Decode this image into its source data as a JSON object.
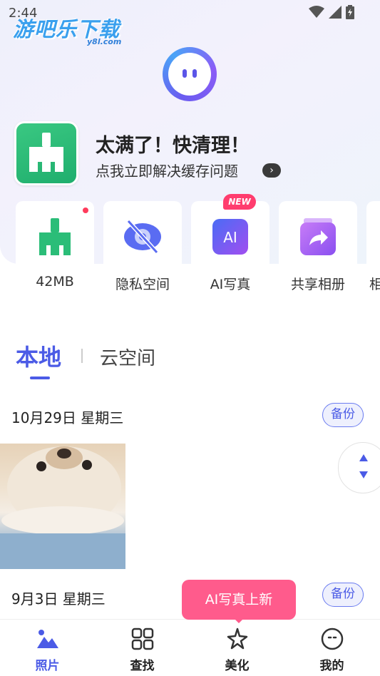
{
  "status_bar": {
    "time": "2:44"
  },
  "watermark": {
    "main": "游吧乐下载",
    "sub": "y8l.com"
  },
  "clean": {
    "title": "太满了！快清理！",
    "subtitle": "点我立即解决缓存问题"
  },
  "tools": [
    {
      "label": "42MB",
      "icon": "broom-icon"
    },
    {
      "label": "隐私空间",
      "icon": "eye-slash-icon"
    },
    {
      "label": "AI写真",
      "icon": "ai-icon",
      "badge": "NEW",
      "icon_text": "AI"
    },
    {
      "label": "共享相册",
      "icon": "share-album-icon"
    },
    {
      "label": "相",
      "icon": "more-tool-icon"
    }
  ],
  "tabs": {
    "local": "本地",
    "cloud": "云空间"
  },
  "sections": [
    {
      "date": "10月29日 星期三",
      "backup": "备份"
    },
    {
      "date": "9月3日 星期三",
      "backup": "备份"
    }
  ],
  "promo": {
    "text": "AI写真上新"
  },
  "nav": [
    {
      "label": "照片",
      "icon": "photos-icon",
      "active": true
    },
    {
      "label": "查找",
      "icon": "grid-icon",
      "active": false
    },
    {
      "label": "美化",
      "icon": "magic-icon",
      "active": false
    },
    {
      "label": "我的",
      "icon": "profile-icon",
      "active": false
    }
  ],
  "colors": {
    "accent": "#4b5be6",
    "green": "#2bbd78",
    "promo": "#ff5b8c",
    "new_badge": "#ff3d6e"
  }
}
